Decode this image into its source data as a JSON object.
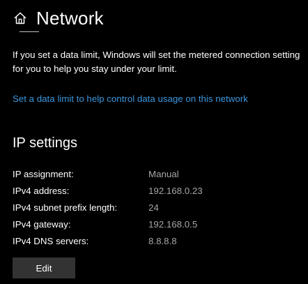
{
  "header": {
    "icon": "home-icon",
    "title": "Network"
  },
  "description": "If you set a data limit, Windows will set the metered connection setting for you to help you stay under your limit.",
  "link": {
    "label": "Set a data limit to help control data usage on this network"
  },
  "ip_settings": {
    "heading": "IP settings",
    "rows": [
      {
        "label": "IP assignment:",
        "value": "Manual"
      },
      {
        "label": "IPv4 address:",
        "value": "192.168.0.23"
      },
      {
        "label": "IPv4 subnet prefix length:",
        "value": "24"
      },
      {
        "label": "IPv4 gateway:",
        "value": "192.168.0.5"
      },
      {
        "label": "IPv4 DNS servers:",
        "value": "8.8.8.8"
      }
    ],
    "edit_label": "Edit"
  },
  "colors": {
    "background": "#000000",
    "text": "#ffffff",
    "muted_value": "#a6a6a6",
    "link": "#3a96dd",
    "button": "#333333"
  }
}
